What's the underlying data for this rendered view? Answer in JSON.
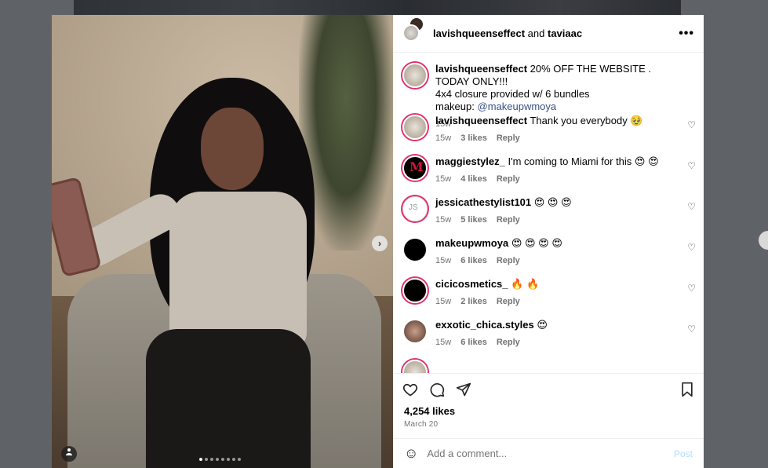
{
  "header": {
    "user1": "lavishqueenseffect",
    "joiner": "and",
    "user2": "taviaac",
    "more": "•••"
  },
  "caption": {
    "username": "lavishqueenseffect",
    "line1": "20% OFF THE WEBSITE . TODAY ONLY!!!",
    "line2": "4x4 closure provided w/ 6 bundles",
    "line3_prefix": "makeup:",
    "mention": "@makeupwmoya",
    "time": "15w"
  },
  "comments": [
    {
      "username": "lavishqueenseffect",
      "text": "Thank you everybody 🥹",
      "time": "15w",
      "likes": "3 likes",
      "reply": "Reply"
    },
    {
      "username": "maggiestylez_",
      "text": "I'm coming to Miami for this 😍 😍",
      "time": "15w",
      "likes": "4 likes",
      "reply": "Reply"
    },
    {
      "username": "jessicathestylist101",
      "text": "😍 😍 😍",
      "time": "15w",
      "likes": "5 likes",
      "reply": "Reply"
    },
    {
      "username": "makeupwmoya",
      "text": "😍 😍 😍 😍",
      "time": "15w",
      "likes": "6 likes",
      "reply": "Reply"
    },
    {
      "username": "cicicosmetics_",
      "text": "🔥 🔥",
      "time": "15w",
      "likes": "2 likes",
      "reply": "Reply"
    },
    {
      "username": "exxotic_chica.styles",
      "text": "😍",
      "time": "15w",
      "likes": "6 likes",
      "reply": "Reply"
    }
  ],
  "post": {
    "likes": "4,254 likes",
    "date": "March 20"
  },
  "add_comment": {
    "placeholder": "Add a comment...",
    "post_label": "Post"
  },
  "media": {
    "next": "›",
    "carousel_count": 8,
    "active_index": 0
  }
}
